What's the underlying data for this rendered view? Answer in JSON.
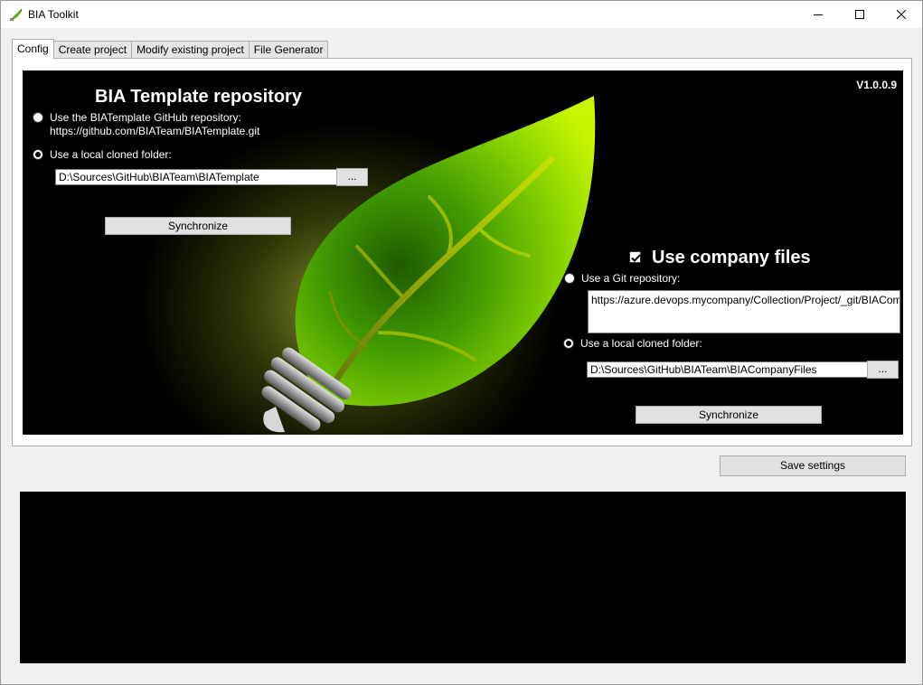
{
  "window": {
    "title": "BIA Toolkit",
    "icon": "bia-toolkit-icon",
    "controls": [
      "minimize-icon",
      "maximize-icon",
      "close-icon"
    ]
  },
  "tabs": [
    {
      "label": "Config",
      "active": true
    },
    {
      "label": "Create project",
      "active": false
    },
    {
      "label": "Modify existing project",
      "active": false
    },
    {
      "label": "File Generator",
      "active": false
    }
  ],
  "config": {
    "version": "V1.0.0.9",
    "template": {
      "heading": "BIA Template repository",
      "option_github_label": "Use the BIATemplate GitHub repository:",
      "option_github_url": "https://github.com/BIATeam/BIATemplate.git",
      "option_github_selected": false,
      "option_local_label": "Use a local cloned folder:",
      "option_local_selected": true,
      "local_path": "D:\\Sources\\GitHub\\BIATeam\\BIATemplate",
      "browse_label": "...",
      "sync_label": "Synchronize"
    },
    "company": {
      "checkbox_checked": true,
      "heading": "Use company files",
      "option_git_label": "Use a Git repository:",
      "option_git_selected": false,
      "git_url": "https://azure.devops.mycompany/Collection/Project/_git/BIACompanyFiles",
      "option_local_label": "Use a local cloned folder:",
      "option_local_selected": true,
      "local_path": "D:\\Sources\\GitHub\\BIATeam\\BIACompanyFiles",
      "browse_label": "...",
      "sync_label": "Synchronize"
    }
  },
  "footer": {
    "save_label": "Save settings",
    "console_text": ""
  },
  "colors": {
    "leaf_light": "#b8f000",
    "leaf_dark": "#2a7a00",
    "background": "#000000"
  }
}
